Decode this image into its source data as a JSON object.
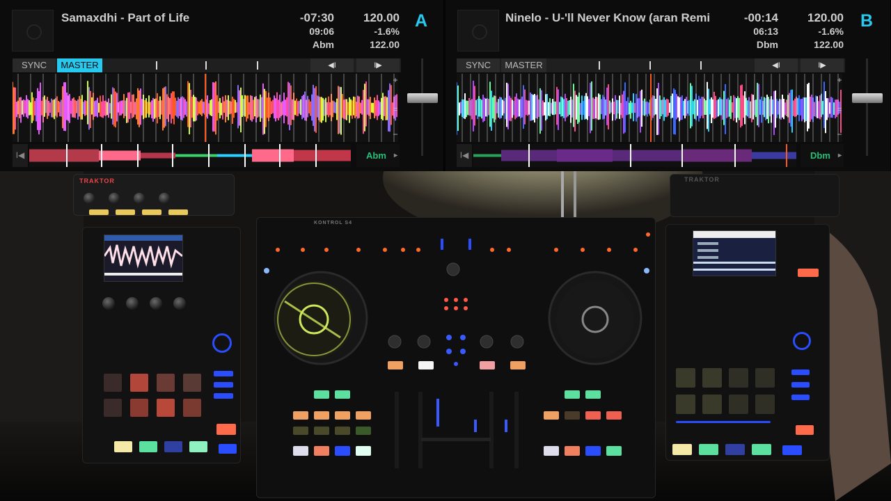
{
  "deck_a": {
    "letter": "A",
    "title": "Samaxdhi - Part of Life",
    "remaining": "-07:30",
    "length": "09:06",
    "key": "Abm",
    "tempo": "120.00",
    "pitch": "-1.6%",
    "original_bpm": "122.00",
    "sync_label": "SYNC",
    "master_label": "MASTER",
    "master_active": true,
    "overview_key": "Abm",
    "accent": "#28c9ef"
  },
  "deck_b": {
    "letter": "B",
    "title": "Ninelo - U-'ll Never Know (aran Remi",
    "remaining": "-00:14",
    "length": "06:13",
    "key": "Dbm",
    "tempo": "120.00",
    "pitch": "-1.6%",
    "original_bpm": "122.00",
    "sync_label": "SYNC",
    "master_label": "MASTER",
    "master_active": false,
    "overview_key": "Dbm"
  },
  "controls": {
    "prev_icon": "backward-beat-icon",
    "next_icon": "forward-beat-icon",
    "zoom_in": "+",
    "zoom_reset": "=",
    "zoom_out": "−",
    "prev_glyph": "◀I",
    "next_glyph": "I▶",
    "skip_start_glyph": "I◀",
    "key_left": "◂",
    "key_right": "▸"
  },
  "photo": {
    "left_unit_brand": "TRAKTOR",
    "right_unit_brand": "TRAKTOR",
    "mixer_label": "KONTROL S4",
    "accent_colors": {
      "pad_yellow": "#e8c95a",
      "pad_red": "#d94a3a",
      "pad_green": "#5be0a0",
      "led_blue": "#2a4dff",
      "led_orange": "#ff6a2a"
    }
  }
}
